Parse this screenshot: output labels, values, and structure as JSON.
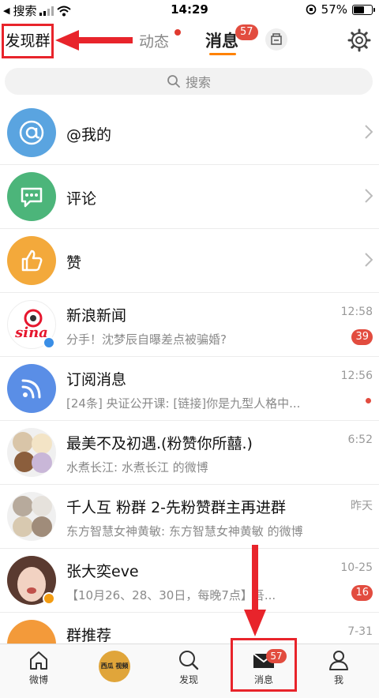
{
  "status_bar": {
    "carrier": "搜索",
    "time": "14:29",
    "battery": "57%",
    "battery_level": 0.57
  },
  "header": {
    "discover_label": "发现群",
    "tab_feed": "动态",
    "tab_messages": "消息",
    "messages_badge": "57"
  },
  "search": {
    "placeholder": "搜索"
  },
  "rows": [
    {
      "title": "@我的",
      "icon": "at-icon",
      "color": "#5aa4e0"
    },
    {
      "title": "评论",
      "icon": "comment-icon",
      "color": "#4cb57a"
    },
    {
      "title": "赞",
      "icon": "thumbs-up-icon",
      "color": "#f3a93b"
    },
    {
      "title": "新浪新闻",
      "sub": "分手！沈梦辰自曝差点被骗婚?",
      "time": "12:58",
      "badge": "39",
      "avatar_text": "sina"
    },
    {
      "title": "订阅消息",
      "sub": "[24条] 央证公开课: [链接]你是九型人格中...",
      "time": "12:56"
    },
    {
      "title": "最美不及初遇.(粉赞你所囍.)",
      "sub": "水煮长江: 水煮长江 的微博",
      "time": "6:52"
    },
    {
      "title": "千人互 粉群 2-先粉赞群主再进群",
      "sub": "东方智慧女神黄敏: 东方智慧女神黄敏 的微博",
      "time": "昨天"
    },
    {
      "title": "张大奕eve",
      "sub": "【10月26、28、30日，每晚7点】吾...",
      "time": "10-25",
      "badge": "16"
    },
    {
      "title": "群推荐",
      "time": "7-31"
    }
  ],
  "tabbar": {
    "home": "微博",
    "video_label": "西瓜 视频",
    "discover": "发现",
    "messages": "消息",
    "messages_badge": "57",
    "me": "我"
  }
}
